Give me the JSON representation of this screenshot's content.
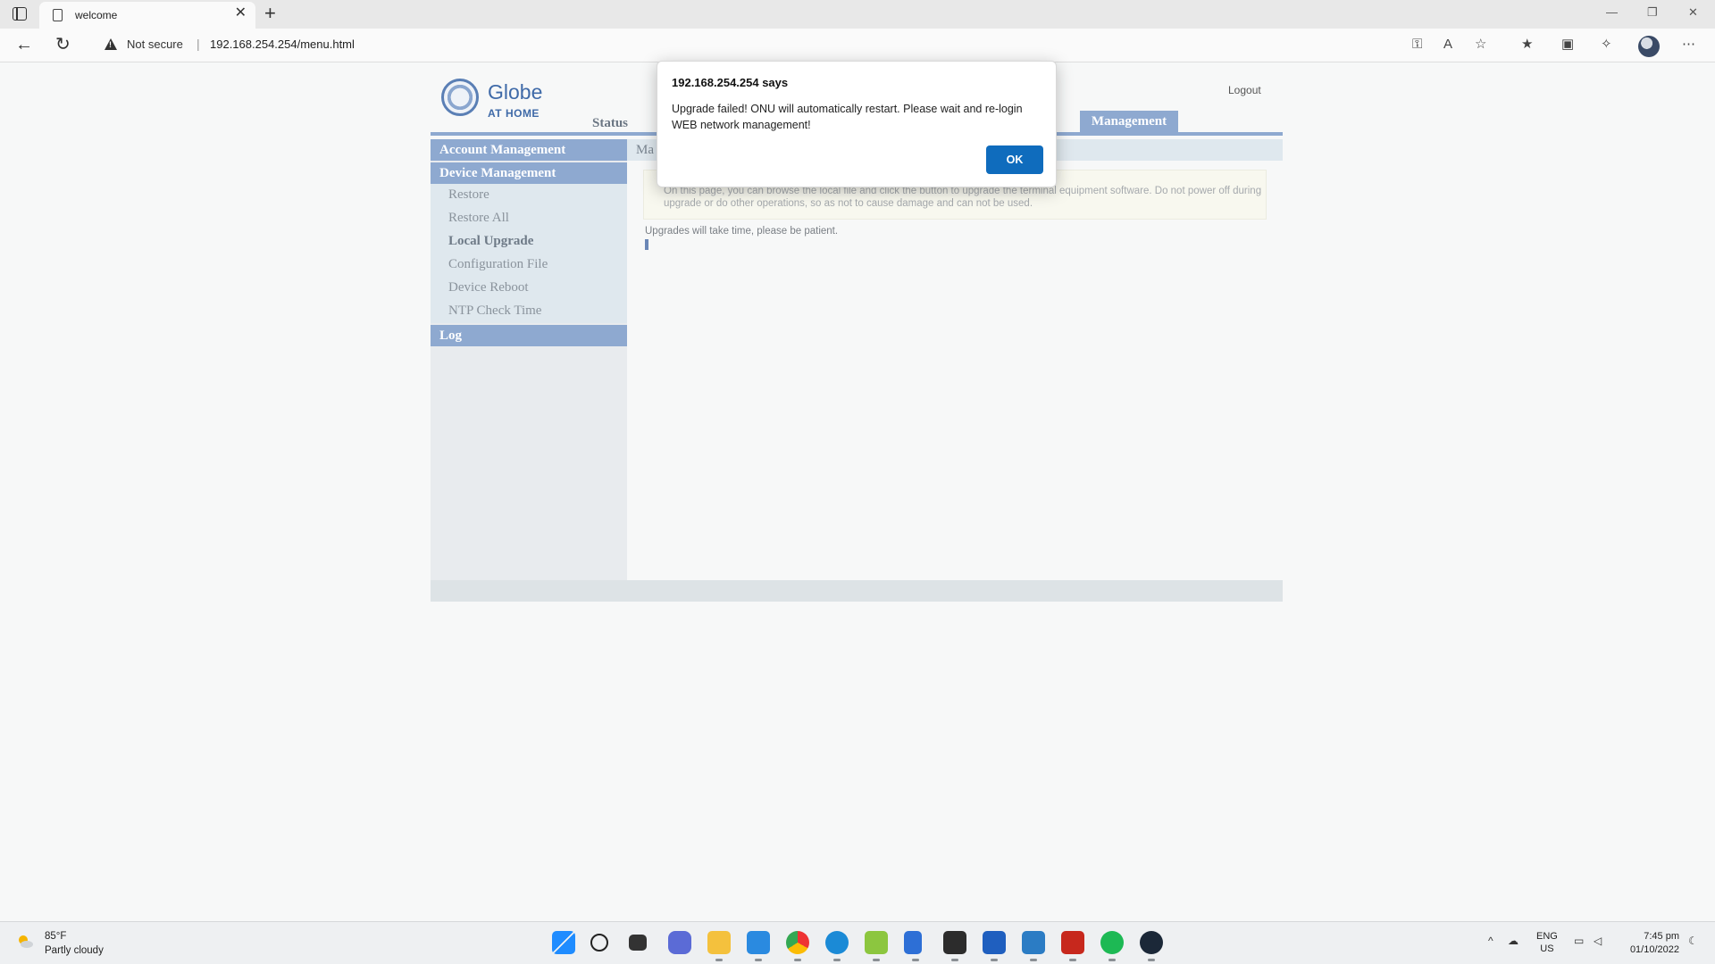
{
  "browser": {
    "tab_title": "welcome",
    "tab_close": "✕",
    "new_tab": "+",
    "not_secure": "Not secure",
    "url": "192.168.254.254/menu.html",
    "controls": {
      "minimize": "—",
      "restore": "❐",
      "close": "✕"
    }
  },
  "header": {
    "logo_name": "Globe",
    "logo_sub": "AT HOME",
    "logout": "Logout",
    "nav_status": "Status",
    "nav_management": "Management"
  },
  "sidebar": {
    "sections": [
      "Account Management",
      "Device Management",
      "Log"
    ],
    "items": [
      "Restore",
      "Restore All",
      "Local Upgrade",
      "Configuration File",
      "Device Reboot",
      "NTP Check Time"
    ],
    "active_item": "Local Upgrade"
  },
  "content": {
    "title": "Ma",
    "note": "On this page, you can browse the local file and click the button to upgrade the terminal equipment software. Do not power off during upgrade or do other operations, so as not to cause damage and can not be used.",
    "patience": "Upgrades will take time, please be patient."
  },
  "dialog": {
    "title": "192.168.254.254 says",
    "message": "Upgrade failed! ONU will automatically restart. Please wait and re-login WEB network management!",
    "ok": "OK"
  },
  "taskbar": {
    "weather_temp": "85°F",
    "weather_desc": "Partly cloudy",
    "lang_top": "ENG",
    "lang_bottom": "US",
    "time": "7:45 pm",
    "date": "01/10/2022"
  },
  "colors": {
    "accent_nav": "#8ea9d0",
    "dialog_button": "#0f6cbd",
    "page_bg": "#f7f8f8"
  }
}
